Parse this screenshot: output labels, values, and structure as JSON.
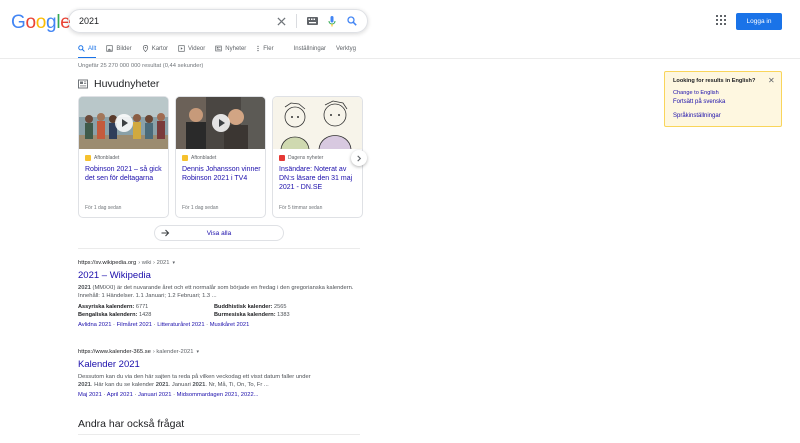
{
  "header": {
    "logo_letters": [
      {
        "ch": "G",
        "color": "#4285F4"
      },
      {
        "ch": "o",
        "color": "#EA4335"
      },
      {
        "ch": "o",
        "color": "#FBBC05"
      },
      {
        "ch": "g",
        "color": "#4285F4"
      },
      {
        "ch": "l",
        "color": "#34A853"
      },
      {
        "ch": "e",
        "color": "#EA4335"
      }
    ],
    "query": "2021",
    "login_label": "Logga in"
  },
  "tabs": [
    {
      "label": "Allt",
      "icon": "search-icon",
      "active": true
    },
    {
      "label": "Bilder",
      "icon": "image-icon",
      "active": false
    },
    {
      "label": "Kartor",
      "icon": "map-pin-icon",
      "active": false
    },
    {
      "label": "Videor",
      "icon": "video-icon",
      "active": false
    },
    {
      "label": "Nyheter",
      "icon": "news-icon",
      "active": false
    },
    {
      "label": "Fler",
      "icon": "more-icon",
      "active": false
    }
  ],
  "tools": {
    "settings": "Inställningar",
    "tools": "Verktyg"
  },
  "stats": "Ungefär 25 270 000 000 resultat (0,44 sekunder)",
  "top_stories": {
    "title": "Huvudnyheter",
    "cards": [
      {
        "source": "Aftonbladet",
        "fav_color": "#f6c12d",
        "headline": "Robinson 2021 – så gick det sen för deltagarna",
        "time": "För 1 dag sedan",
        "video": true
      },
      {
        "source": "Aftonbladet",
        "fav_color": "#f6c12d",
        "headline": "Dennis Johansson vinner Robinson 2021 i TV4",
        "time": "För 1 dag sedan",
        "video": true
      },
      {
        "source": "Dagens nyheter",
        "fav_color": "#e53935",
        "headline": "Insändare: Noterat av DN:s läsare den 31 maj 2021 - DN.SE",
        "time": "För 5 timmar sedan",
        "video": false
      }
    ],
    "show_all": "Visa alla"
  },
  "results": [
    {
      "site": "https://sv.wikipedia.org",
      "path": "› wiki › 2021",
      "title": "2021 – Wikipedia",
      "snippet_bold": "2021",
      "snippet": " (MMXXI) är det nuvarande året och ett normalår som började en fredag i den gregorianska kalendern. Innehåll: 1 Händelser. 1.1 Januari; 1.2 Februari; 1.3 ...",
      "facts": [
        {
          "k": "Assyriska kalendern:",
          "v": "6771"
        },
        {
          "k": "Buddhistisk kalender:",
          "v": "2565"
        },
        {
          "k": "Bengaliska kalendern:",
          "v": "1428"
        },
        {
          "k": "Burmesiska kalendern:",
          "v": "1383"
        }
      ],
      "sitelinks": [
        "Avlidna 2021",
        "Filmåret 2021",
        "Litteraturåret 2021",
        "Musikåret 2021"
      ]
    },
    {
      "site": "https://www.kalender-365.se",
      "path": "› kalender-2021",
      "title": "Kalender 2021",
      "snippet_l1": "Dessutom kan du via den här sajten ta reda på vilken veckodag ett visst datum faller under",
      "snippet_l2a": "2021",
      "snippet_l2b": ". Här kan du se kalender ",
      "snippet_l2c": "2021",
      "snippet_l2d": ". Januari ",
      "snippet_l2e": "2021",
      "snippet_l2f": ". Nr, Må, Ti, On, To, Fr ...",
      "sitelinks": [
        "Maj 2021",
        "April 2021",
        "Januari 2021",
        "Midsommardagen 2021, 2022..."
      ]
    }
  ],
  "paa_title": "Andra har också frågat",
  "language_box": {
    "question": "Looking for results in English?",
    "change": "Change to English",
    "continue": "Fortsätt på svenska",
    "settings": "Språkinställningar"
  }
}
